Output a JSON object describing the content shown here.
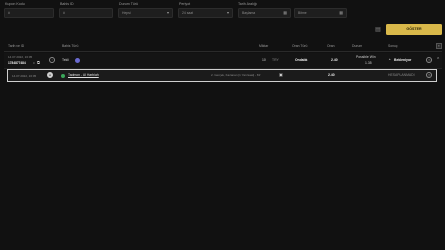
{
  "filters": {
    "kupon_label": "Kupon Kodu",
    "kupon_value": "#",
    "bahis_label": "Bahis ID",
    "bahis_value": "#",
    "durum_label": "Durum Türü",
    "durum_value": "Hepsi",
    "periyot_label": "Periyot",
    "periyot_value": "24 saat",
    "tarih_label": "Tarih Aralığı",
    "tarih_start": "Başlama",
    "tarih_end": "Bitme"
  },
  "actions": {
    "goster": "GÖSTER"
  },
  "columns": {
    "tarih_id": "Tarih ve ID",
    "bahis_turu": "Bahis Türü",
    "miktar": "Miktar",
    "oran_turu": "Oran Türü",
    "oran": "Oran",
    "durum": "Durum",
    "sonuc": "Sonuç"
  },
  "row1": {
    "date": "14.07.2022, 16:05",
    "id": "1784877484",
    "id_suffix": "0",
    "type": "Tekli",
    "amount": "10",
    "currency": "TRY",
    "odds_type": "Ondalık",
    "odds": "2.40",
    "status": "Possible Win",
    "status_value": "1.35",
    "result": "Bekleniyor"
  },
  "row2": {
    "date": "14.07.2022, 16:05",
    "match": "Tadmon - Al Harbiah",
    "market": "2. Gerçek, Kazanan [1 Yarı/saat] - 81'",
    "odds": "2.40",
    "result": "HESAPLANMADI"
  }
}
